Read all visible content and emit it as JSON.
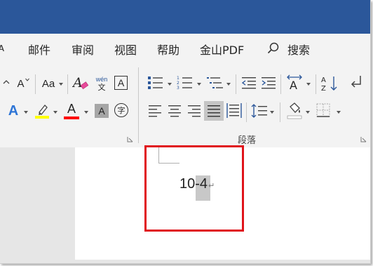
{
  "menu": {
    "items": [
      "邮件",
      "审阅",
      "视图",
      "帮助",
      "金山PDF"
    ],
    "partial_left": "ᴀ",
    "search_label": "搜索"
  },
  "ribbon": {
    "font": {
      "change_case_label": "Aa",
      "shrink_font_label": "A",
      "phonetic_top": "wén",
      "phonetic_bottom": "文",
      "border_char_label": "A",
      "enclose_char_label": "字",
      "font_color_label": "A",
      "shading_label": "A",
      "text_effects_label": "A"
    },
    "paragraph": {
      "group_label": "段落",
      "sort_label": "AZ"
    }
  },
  "document": {
    "text": "10-4",
    "paragraph_mark": "↵"
  },
  "colors": {
    "title_bar": "#2b579a",
    "highlight_yellow": "#ffff00",
    "font_color_red": "#ff0000",
    "callout_red": "#e0141b",
    "selection": "#c8c8c8"
  }
}
